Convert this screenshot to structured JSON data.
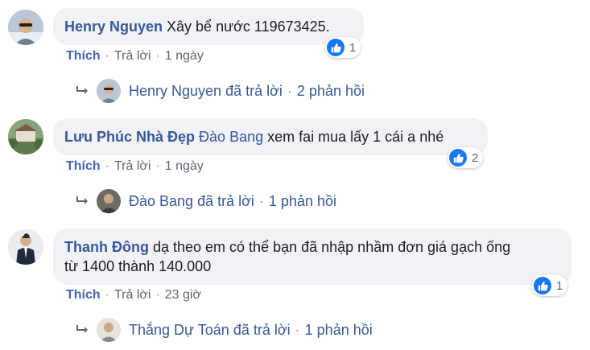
{
  "colors": {
    "name_blue": "#385898",
    "like_blue": "#1877f2",
    "bubble_bg": "#f0f2f5",
    "meta_gray": "#606770"
  },
  "action_labels": {
    "like": "Thích",
    "reply": "Trả lời",
    "dot": "·"
  },
  "comments": [
    {
      "author": "Henry Nguyen",
      "tag": "",
      "text": "Xây bể nước 119673425.",
      "text_line2": "",
      "like_count": "1",
      "time": "1 ngày",
      "avatar_icon": "man-with-sunglasses-avatar",
      "replies": {
        "name": "Henry Nguyen",
        "label": "đã trả lời",
        "count": "2 phản hồi"
      }
    },
    {
      "author": "Lưu Phúc Nhà Đẹp",
      "tag": "Đào Bang",
      "text": "xem fai mua lấy 1 cái a nhé",
      "text_line2": "",
      "like_count": "2",
      "time": "1 ngày",
      "avatar_icon": "house-garden-avatar",
      "replies": {
        "name": "Đào Bang",
        "label": "đã trả lời",
        "count": "1 phản hồi"
      }
    },
    {
      "author": "Thanh Đông",
      "tag": "",
      "text": "dạ theo em có thể bạn đã nhập nhầm đơn giá gạch ống",
      "text_line2": "từ 1400 thành 140.000",
      "like_count": "1",
      "time": "23 giờ",
      "avatar_icon": "man-in-suit-avatar",
      "replies": {
        "name": "Thắng Dự Toán",
        "label": "đã trả lời",
        "count": "1 phản hồi"
      }
    }
  ]
}
